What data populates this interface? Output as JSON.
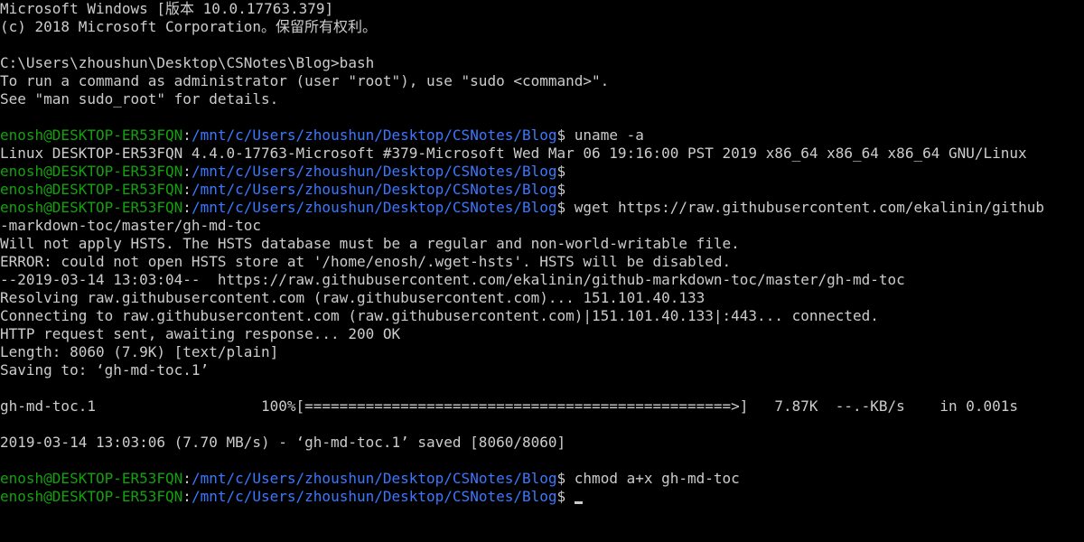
{
  "terminal": {
    "colors": {
      "background": "#000000",
      "foreground": "#cccccc",
      "user_host": "#13a10e",
      "path": "#3b78ff"
    },
    "prompt": {
      "user_host": "enosh@DESKTOP-ER53FQN",
      "separator": ":",
      "path": "/mnt/c/Users/zhoushun/Desktop/CSNotes/Blog",
      "symbol": "$"
    },
    "lines": [
      "Microsoft Windows [版本 10.0.17763.379]",
      "(c) 2018 Microsoft Corporation。保留所有权利。",
      "",
      "C:\\Users\\zhoushun\\Desktop\\CSNotes\\Blog>bash",
      "To run a command as administrator (user \"root\"), use \"sudo <command>\".",
      "See \"man sudo_root\" for details.",
      "",
      "Linux DESKTOP-ER53FQN 4.4.0-17763-Microsoft #379-Microsoft Wed Mar 06 19:16:00 PST 2019 x86_64 x86_64 x86_64 GNU/Linux",
      "-markdown-toc/master/gh-md-toc",
      "Will not apply HSTS. The HSTS database must be a regular and non-world-writable file.",
      "ERROR: could not open HSTS store at '/home/enosh/.wget-hsts'. HSTS will be disabled.",
      "--2019-03-14 13:03:04--  https://raw.githubusercontent.com/ekalinin/github-markdown-toc/master/gh-md-toc",
      "Resolving raw.githubusercontent.com (raw.githubusercontent.com)... 151.101.40.133",
      "Connecting to raw.githubusercontent.com (raw.githubusercontent.com)|151.101.40.133|:443... connected.",
      "HTTP request sent, awaiting response... 200 OK",
      "Length: 8060 (7.9K) [text/plain]",
      "Saving to: ‘gh-md-toc.1’",
      "",
      "gh-md-toc.1                   100%[=================================================>]   7.87K  --.-KB/s    in 0.001s",
      "",
      "2019-03-14 13:03:06 (7.70 MB/s) - ‘gh-md-toc.1’ saved [8060/8060]",
      ""
    ],
    "commands": {
      "uname": " uname -a",
      "empty1": "",
      "empty2": "",
      "wget": " wget https://raw.githubusercontent.com/ekalinin/github",
      "chmod": " chmod a+x gh-md-toc",
      "current": " "
    }
  }
}
